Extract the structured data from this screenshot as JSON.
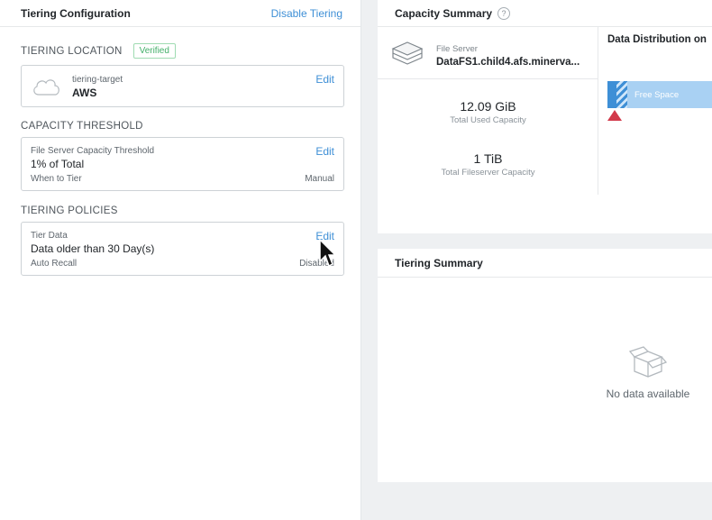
{
  "tiering_config": {
    "title": "Tiering Configuration",
    "disable_link": "Disable Tiering",
    "location": {
      "heading": "TIERING LOCATION",
      "badge": "Verified",
      "label": "tiering-target",
      "value": "AWS",
      "edit": "Edit"
    },
    "threshold": {
      "heading": "CAPACITY THRESHOLD",
      "label": "File Server Capacity Threshold",
      "value": "1% of Total",
      "foot_label": "When to Tier",
      "foot_value": "Manual",
      "edit": "Edit"
    },
    "policies": {
      "heading": "TIERING POLICIES",
      "label": "Tier Data",
      "value": "Data older than 30 Day(s)",
      "foot_label": "Auto Recall",
      "foot_value": "Disabled",
      "edit": "Edit"
    }
  },
  "capacity_summary": {
    "title": "Capacity Summary",
    "help": "?",
    "file_server_label": "File Server",
    "file_server_name": "DataFS1.child4.afs.minerva...",
    "used_value": "12.09 GiB",
    "used_caption": "Total Used Capacity",
    "total_value": "1 TiB",
    "total_caption": "Total Fileserver Capacity",
    "distribution_title": "Data Distribution on",
    "free_space_label": "Free Space"
  },
  "tiering_summary": {
    "title": "Tiering Summary",
    "empty_text": "No data available"
  },
  "colors": {
    "accent": "#3e8fd6",
    "verified": "#44b06a",
    "marker": "#d2394a"
  }
}
